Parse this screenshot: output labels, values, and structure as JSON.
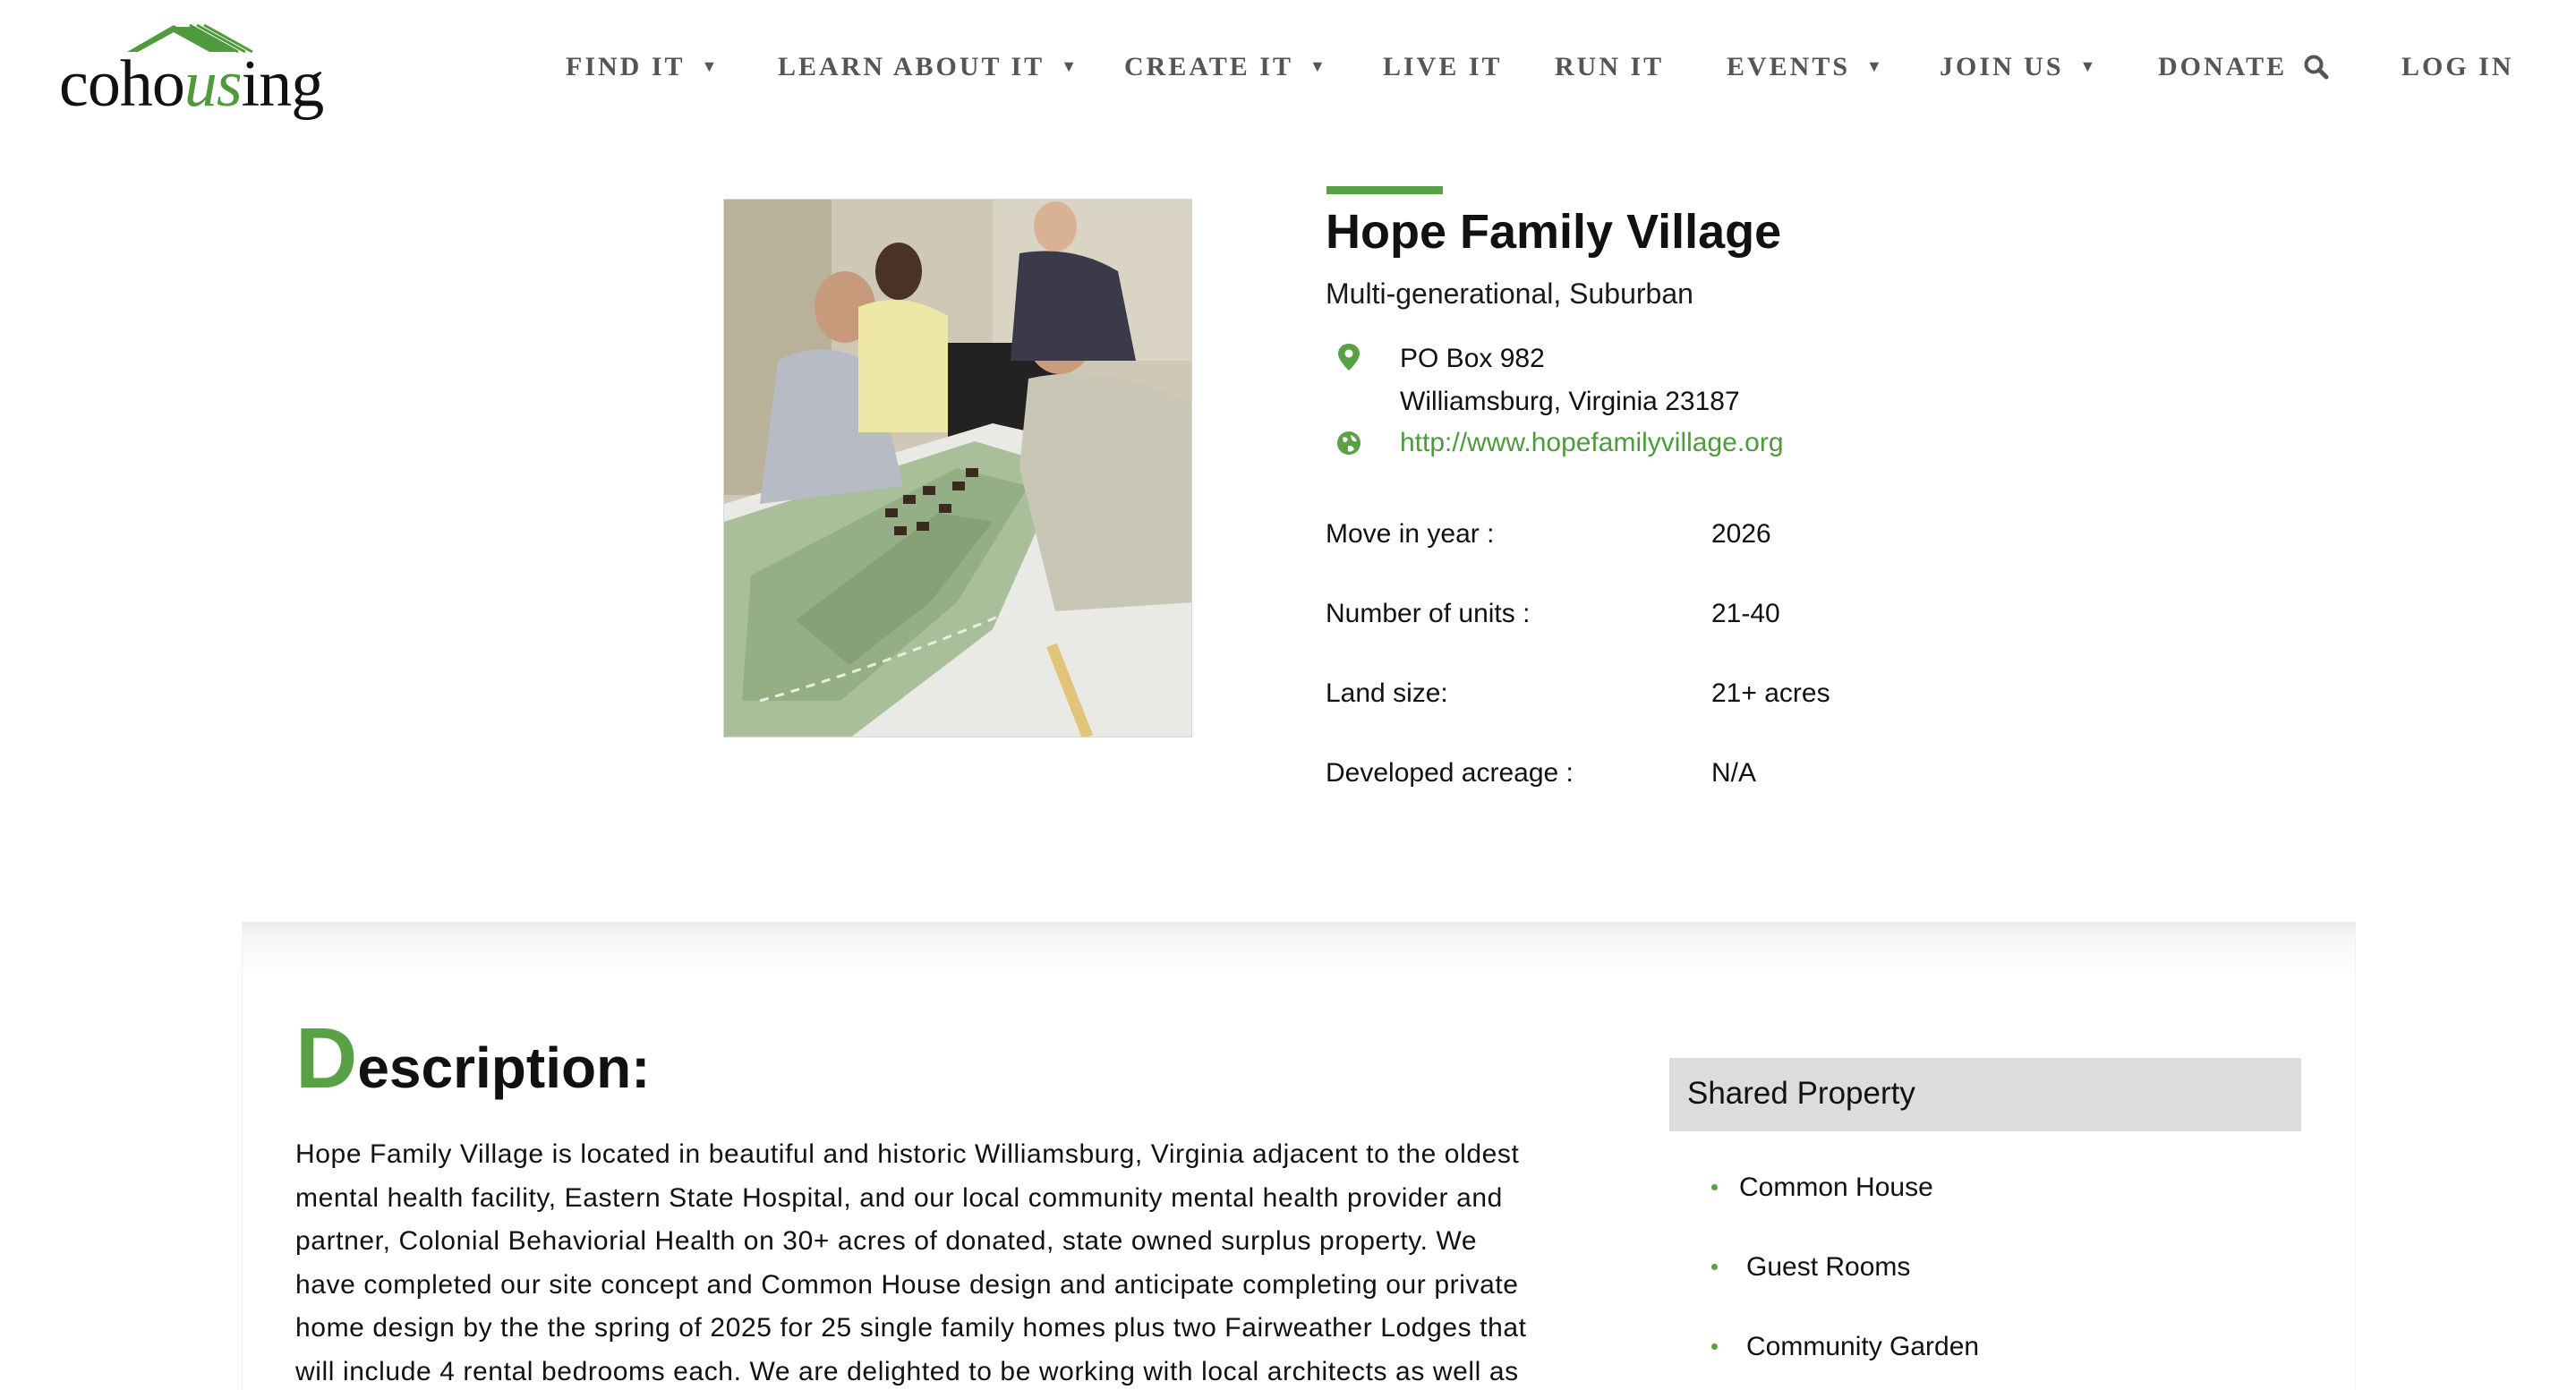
{
  "logo": {
    "text_before": "coho",
    "text_us": "us",
    "text_after": "ing"
  },
  "nav": {
    "items": [
      {
        "label": "FIND IT",
        "dropdown": true
      },
      {
        "label": "LEARN ABOUT IT",
        "dropdown": true
      },
      {
        "label": "CREATE IT",
        "dropdown": true
      },
      {
        "label": "LIVE IT",
        "dropdown": false
      },
      {
        "label": "RUN IT",
        "dropdown": false
      },
      {
        "label": "EVENTS",
        "dropdown": true
      },
      {
        "label": "JOIN US",
        "dropdown": true
      },
      {
        "label": "DONATE",
        "dropdown": false
      }
    ],
    "caret": "▼",
    "search_icon": "search-icon",
    "login": "LOG IN"
  },
  "community": {
    "name": "Hope Family Village",
    "type": "Multi-generational, Suburban",
    "address_line1": "PO Box 982",
    "address_line2": "Williamsburg, Virginia 23187",
    "website": "http://www.hopefamilyvillage.org",
    "stats": [
      {
        "label": "Move in year :",
        "value": "2026"
      },
      {
        "label": "Number of units :",
        "value": "21-40"
      },
      {
        "label": "Land size:",
        "value": "21+ acres"
      },
      {
        "label": "Developed acreage :",
        "value": "N/A"
      }
    ]
  },
  "description": {
    "heading_initial": "D",
    "heading_rest": "escription:",
    "lines": [
      "Hope Family Village is located in beautiful and historic Williamsburg, Virginia adjacent to the oldest",
      "mental health facility, Eastern State Hospital, and our local community mental health provider and",
      "partner, Colonial Behaviorial Health on 30+ acres of donated, state owned surplus property. We",
      "have completed our site concept and Common House design and anticipate completing our private",
      "home design by the the spring of 2025 for 25 single family homes plus two Fairweather Lodges that",
      "will include 4 rental bedrooms each. We are delighted to be working with local architects as well as"
    ]
  },
  "shared_property": {
    "title": "Shared Property",
    "items": [
      "Common House",
      "Guest Rooms",
      "Community Garden"
    ]
  },
  "colors": {
    "accent_green": "#5aa045",
    "link_green": "#4e9a3d",
    "nav_gray": "#555555",
    "shared_box_bg": "#dcdcdc"
  }
}
